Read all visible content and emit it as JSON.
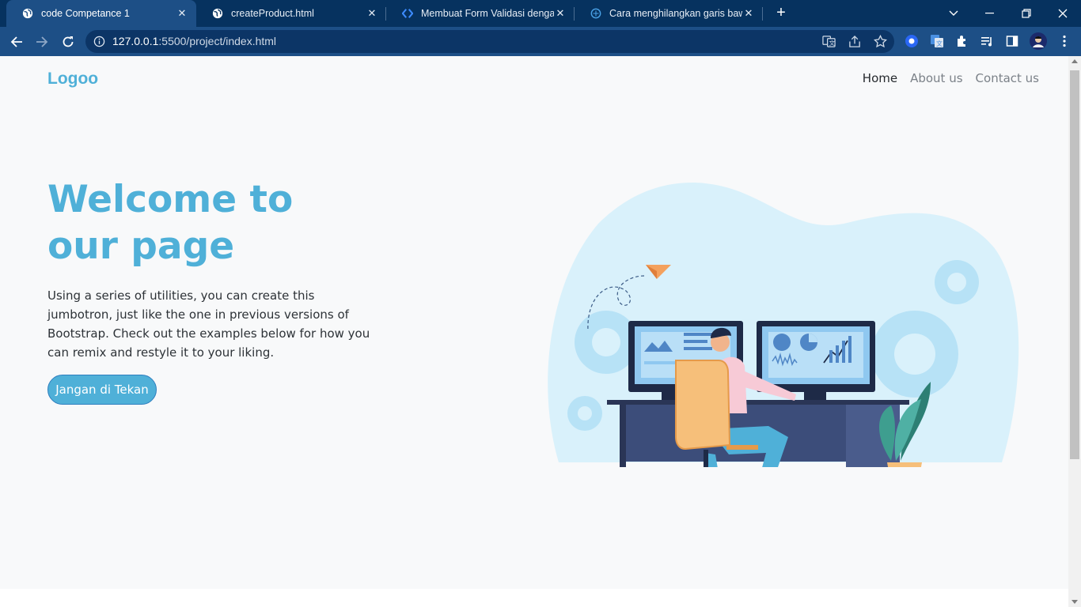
{
  "browser": {
    "tabs": [
      {
        "title": "code Competance 1",
        "active": true,
        "favicon": "globe-icon"
      },
      {
        "title": "createProduct.html",
        "active": false,
        "favicon": "globe-icon"
      },
      {
        "title": "Membuat Form Validasi dengan",
        "active": false,
        "favicon": "code-brackets-icon"
      },
      {
        "title": "Cara menghilangkan garis bawah",
        "active": false,
        "favicon": "site-icon"
      }
    ],
    "url_host": "127.0.0.1",
    "url_rest": ":5500/project/index.html",
    "colors": {
      "tabbar": "#06325f",
      "toolbar": "#1d4f86",
      "omnibox": "#0c3566"
    }
  },
  "page": {
    "logo": "Logoo",
    "nav": {
      "home": "Home",
      "about": "About us",
      "contact": "Contact us"
    },
    "hero": {
      "title_line1": "Welcome to",
      "title_line2": "our page",
      "text": "Using a series of utilities, you can create this jumbotron, just like the one in previous versions of Bootstrap. Check out the examples below for how you can remix and restyle it to your liking.",
      "button": "Jangan di Tekan"
    },
    "colors": {
      "accent": "#4fb0d8",
      "background": "#f8f9fa"
    }
  }
}
